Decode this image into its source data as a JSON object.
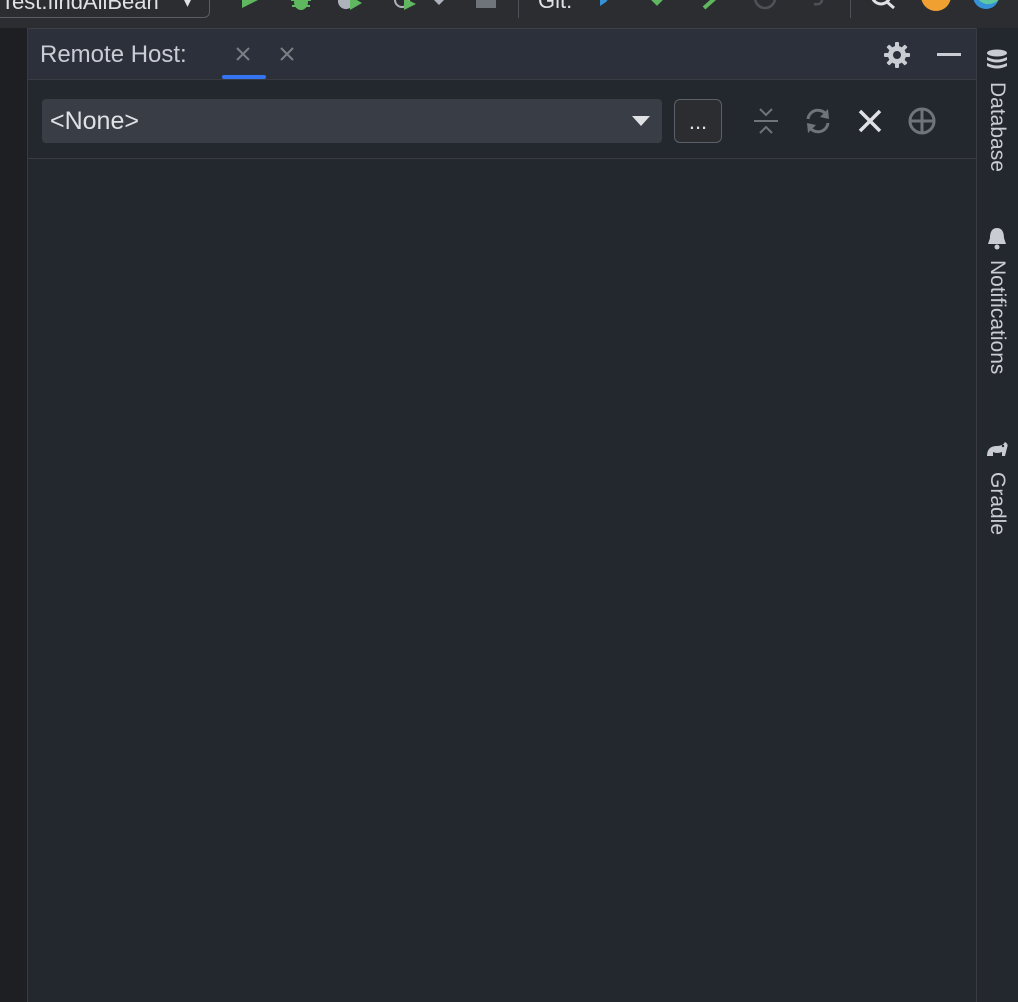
{
  "toolbar": {
    "run_config": "Test.findAllBean",
    "git_label": "Git:"
  },
  "panel": {
    "title": "Remote Host:"
  },
  "host_select": {
    "value": "<None>"
  },
  "browse_button": {
    "label": "..."
  },
  "right_stripe": {
    "items": [
      {
        "label": "Database",
        "icon": "database-icon"
      },
      {
        "label": "Notifications",
        "icon": "bell-icon"
      },
      {
        "label": "Gradle",
        "icon": "gradle-elephant-icon"
      }
    ]
  },
  "colors": {
    "accent": "#3574f0",
    "run_green": "#5fb85f",
    "update_badge": "#f0a030",
    "panel_bg": "#23272e"
  }
}
